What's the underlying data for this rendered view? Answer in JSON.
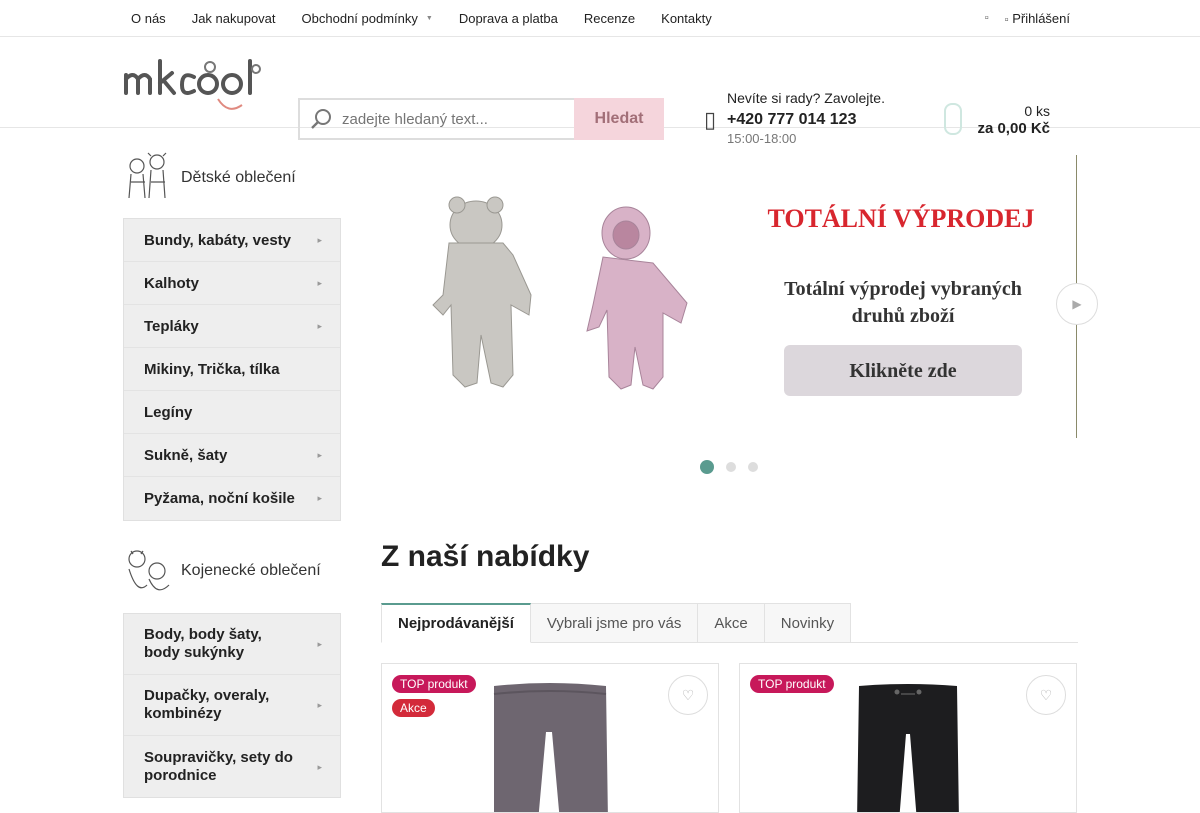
{
  "topnav": {
    "items": [
      "O nás",
      "Jak nakupovat",
      "Obchodní podmínky",
      "Doprava a platba",
      "Recenze",
      "Kontakty"
    ],
    "login_label": "Přihlášení"
  },
  "search": {
    "placeholder": "zadejte hledaný text...",
    "button_label": "Hledat"
  },
  "contact": {
    "question": "Nevíte si rady? Zavolejte.",
    "phone": "+420 777 014 123",
    "hours": "15:00-18:00"
  },
  "cart": {
    "count": "0 ks",
    "total": "za 0,00 Kč"
  },
  "sidebar": {
    "group1": {
      "title": "Dětské oblečení",
      "items": [
        "Bundy, kabáty, vesty",
        "Kalhoty",
        "Tepláky",
        "Mikiny, Trička, tílka",
        "Legíny",
        "Sukně, šaty",
        "Pyžama, noční košile"
      ]
    },
    "group2": {
      "title": "Kojenecké oblečení",
      "items": [
        "Body, body šaty, body sukýnky",
        "Dupačky, overaly, kombinézy",
        "Soupravičky, sety do porodnice"
      ]
    }
  },
  "slider": {
    "headline": "TOTÁLNÍ VÝPRODEJ",
    "subtitle_line1": "Totální výprodej vybraných",
    "subtitle_line2": "druhů zboží",
    "cta": "Klikněte zde",
    "active_slide": 1,
    "slide_count": 3
  },
  "offer": {
    "title": "Z naší nabídky",
    "tabs": [
      "Nejprodávanější",
      "Vybrali jsme pro vás",
      "Akce",
      "Novinky"
    ]
  },
  "products": [
    {
      "badges": [
        "TOP produkt",
        "Akce"
      ],
      "color": "#6e6670"
    },
    {
      "badges": [
        "TOP produkt"
      ],
      "color": "#1d1d1f"
    }
  ],
  "colors": {
    "accent": "#5a9b8f",
    "search_button_bg": "#f5d5dc",
    "badge_top": "#c7185a",
    "badge_akce": "#d32a3a",
    "headline_red": "#d8262e"
  }
}
